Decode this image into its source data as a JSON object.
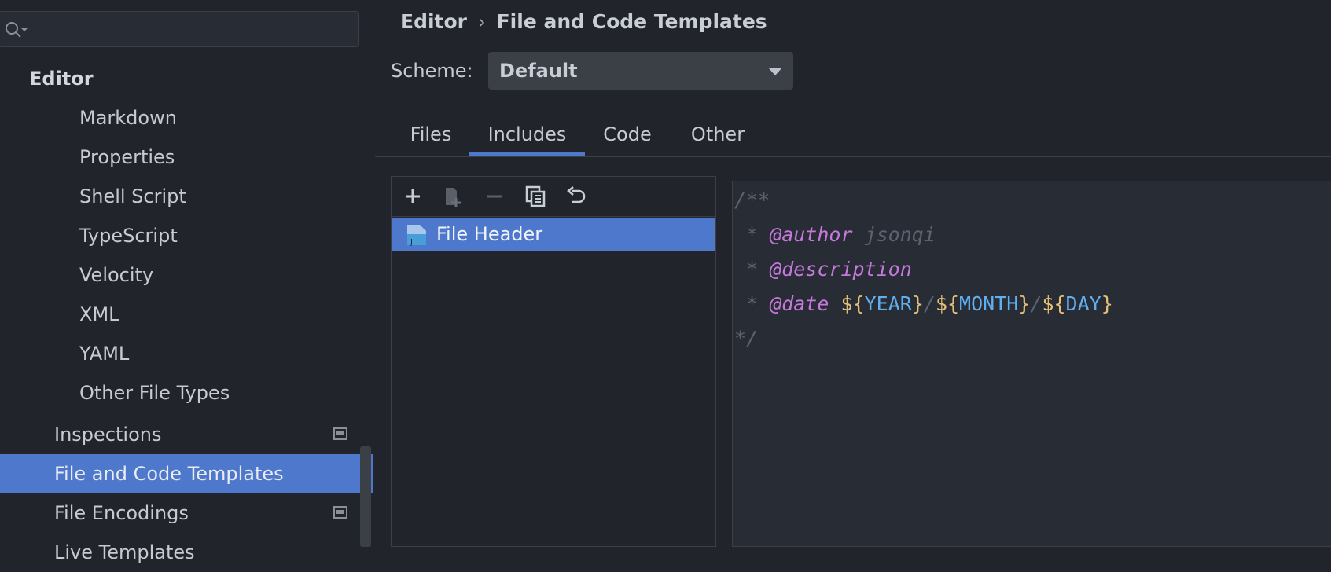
{
  "sidebar": {
    "search": {
      "placeholder": ""
    },
    "items": [
      {
        "label": "Editor",
        "level": 0
      },
      {
        "label": "Markdown",
        "level": 2
      },
      {
        "label": "Properties",
        "level": 2
      },
      {
        "label": "Shell Script",
        "level": 2
      },
      {
        "label": "TypeScript",
        "level": 2
      },
      {
        "label": "Velocity",
        "level": 2
      },
      {
        "label": "XML",
        "level": 2
      },
      {
        "label": "YAML",
        "level": 2
      },
      {
        "label": "Other File Types",
        "level": 2
      },
      {
        "label": "Inspections",
        "level": 1,
        "project_icon": true
      },
      {
        "label": "File and Code Templates",
        "level": 1,
        "selected": true
      },
      {
        "label": "File Encodings",
        "level": 1,
        "project_icon": true
      },
      {
        "label": "Live Templates",
        "level": 1
      }
    ]
  },
  "breadcrumb": {
    "parent": "Editor",
    "separator": "›",
    "current": "File and Code Templates"
  },
  "scheme": {
    "label": "Scheme:",
    "value": "Default"
  },
  "tabs": [
    {
      "label": "Files"
    },
    {
      "label": "Includes",
      "active": true
    },
    {
      "label": "Code"
    },
    {
      "label": "Other"
    }
  ],
  "toolbar": {
    "icons": [
      "add-icon",
      "copy-template-icon",
      "remove-icon",
      "duplicate-icon",
      "reset-icon"
    ]
  },
  "templates": [
    {
      "label": "File Header",
      "icon": "java-file-icon",
      "selected": true
    }
  ],
  "editor": {
    "line1": "/**",
    "line2": {
      "star": " * ",
      "tag": "@author",
      "rest": " jsonqi"
    },
    "line3": {
      "star": " * ",
      "tag": "@description"
    },
    "line4": {
      "star": " * ",
      "tag": "@date",
      "sp": " ",
      "d1": "${",
      "v1": "YEAR",
      "c1": "}",
      "s1": "/",
      "d2": "${",
      "v2": "MONTH",
      "c2": "}",
      "s2": "/",
      "d3": "${",
      "v3": "DAY",
      "c3": "}"
    },
    "line5": "*/"
  },
  "colors": {
    "background": "#21252b",
    "selection": "#4d78cc",
    "editor_bg": "#282c34",
    "comment": "#5c6370",
    "tag": "#c678dd",
    "brace": "#e5c07b",
    "variable": "#61afef"
  }
}
